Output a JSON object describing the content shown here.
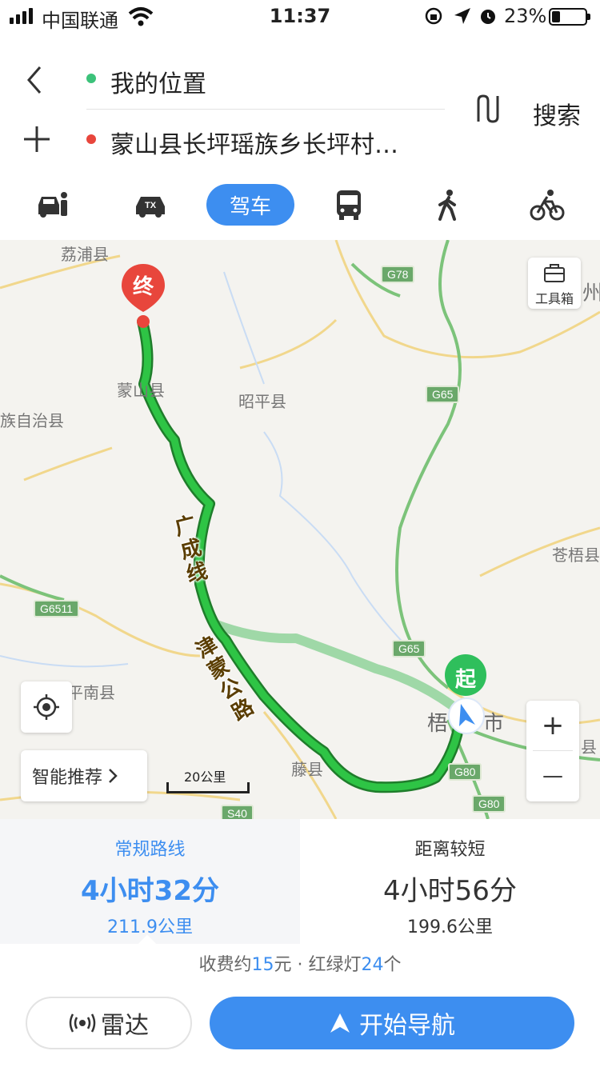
{
  "status_bar": {
    "carrier": "中国联通",
    "time": "11:37",
    "battery_percent": "23%"
  },
  "route": {
    "origin": "我的位置",
    "destination": "蒙山县长坪瑶族乡长坪村…",
    "search_label": "搜索"
  },
  "modes": {
    "active_label": "驾车",
    "items": [
      "carpool-icon",
      "taxi-icon",
      "驾车",
      "bus-icon",
      "walk-icon",
      "bike-icon"
    ]
  },
  "map": {
    "place_labels": [
      {
        "id": "lipu",
        "text": "荔浦县"
      },
      {
        "id": "mengshan",
        "text": "蒙山县"
      },
      {
        "id": "zhaoping",
        "text": "昭平县"
      },
      {
        "id": "zizhi",
        "text": "族自治县"
      },
      {
        "id": "cangwu",
        "text": "苍梧县"
      },
      {
        "id": "pingnan",
        "text": "平南县"
      },
      {
        "id": "tengxian",
        "text": "藤县"
      },
      {
        "id": "wuzhou_a",
        "text": "梧"
      },
      {
        "id": "wuzhou_b",
        "text": "市"
      },
      {
        "id": "edge_zhou",
        "text": "州"
      },
      {
        "id": "edge_xian",
        "text": "县"
      }
    ],
    "shields": [
      "G78",
      "G65",
      "G65",
      "G6511",
      "G80",
      "G80",
      "S40"
    ],
    "road_labels": [
      "广成线",
      "津蒙公路"
    ],
    "end_marker": "终",
    "start_marker": "起",
    "toolbox_label": "工具箱",
    "recommend_label": "智能推荐",
    "scale_label": "20公里",
    "zoom_in": "+",
    "zoom_out": "—"
  },
  "routes": [
    {
      "name": "常规路线",
      "duration": "4小时32分",
      "distance": "211.9公里",
      "selected": true
    },
    {
      "name": "距离较短",
      "duration": "4小时56分",
      "distance": "199.6公里",
      "selected": false
    }
  ],
  "info": {
    "toll_prefix": "收费约",
    "toll_value": "15",
    "toll_unit": "元 · 红绿灯",
    "lights_value": "24",
    "lights_unit": "个"
  },
  "actions": {
    "radar_label": "雷达",
    "navigate_label": "开始导航"
  },
  "colors": {
    "accent": "#3d8ef0",
    "route_main": "#28b53c",
    "route_alt": "#9fd8a7",
    "end_marker": "#e8463c",
    "start_marker": "#2fbf5c"
  }
}
